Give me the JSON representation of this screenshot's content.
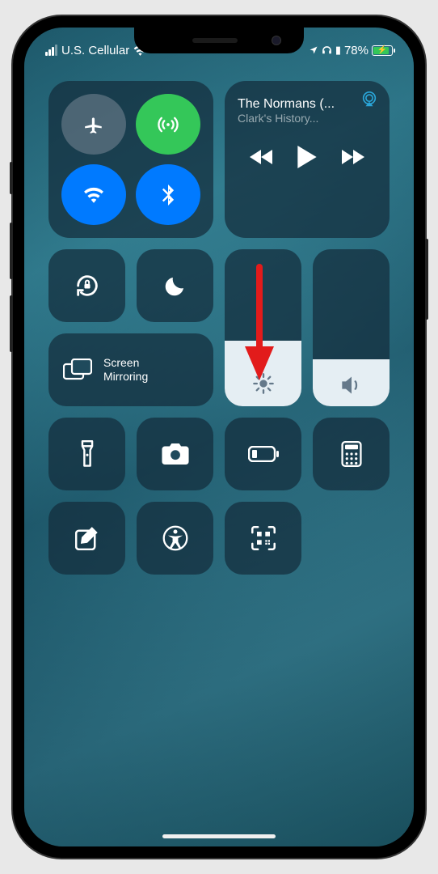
{
  "status": {
    "carrier": "U.S. Cellular",
    "battery_pct": "78%"
  },
  "media": {
    "title": "The Normans (...",
    "subtitle": "Clark's History..."
  },
  "sliders": {
    "brightness_pct": 42,
    "volume_pct": 30
  },
  "labels": {
    "screen_mirroring": "Screen Mirroring"
  },
  "icons": {
    "airplane": "airplane",
    "cellular": "cellular-antenna",
    "wifi": "wifi",
    "bluetooth": "bluetooth",
    "orientation_lock": "orientation-lock",
    "dnd": "moon",
    "flashlight": "flashlight",
    "camera": "camera",
    "low_power": "battery-low-power",
    "calculator": "calculator",
    "notes": "compose",
    "accessibility": "accessibility",
    "qr": "qr-scan",
    "brightness": "sun",
    "volume": "speaker"
  },
  "annotation": {
    "type": "arrow-down",
    "color": "#e21b1b"
  }
}
